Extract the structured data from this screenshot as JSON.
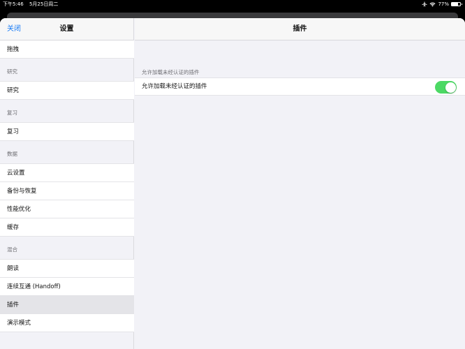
{
  "status_bar": {
    "time": "下午5:46",
    "date": "5月25日周二",
    "battery": "77%",
    "battery_level": 0.77
  },
  "sidebar": {
    "close_label": "关闭",
    "title": "设置",
    "rows": [
      {
        "kind": "item",
        "label": "拖拽"
      },
      {
        "kind": "header",
        "label": "研究"
      },
      {
        "kind": "item",
        "label": "研究"
      },
      {
        "kind": "header",
        "label": "复习"
      },
      {
        "kind": "item",
        "label": "复习"
      },
      {
        "kind": "header",
        "label": "数据"
      },
      {
        "kind": "item",
        "label": "云设置"
      },
      {
        "kind": "item",
        "label": "备份与恢复"
      },
      {
        "kind": "item",
        "label": "性能优化"
      },
      {
        "kind": "item",
        "label": "缓存"
      },
      {
        "kind": "header",
        "label": "混合"
      },
      {
        "kind": "item",
        "label": "朗读"
      },
      {
        "kind": "item",
        "label": "连续互通 (Handoff)"
      },
      {
        "kind": "item",
        "label": "插件",
        "selected": true
      },
      {
        "kind": "item",
        "label": "演示模式"
      }
    ]
  },
  "detail": {
    "title": "插件",
    "section_header": "允许加载未经认证的插件",
    "setting_label": "允许加载未经认证的插件",
    "toggle_on": true,
    "toggle_color": "#4cd964"
  }
}
